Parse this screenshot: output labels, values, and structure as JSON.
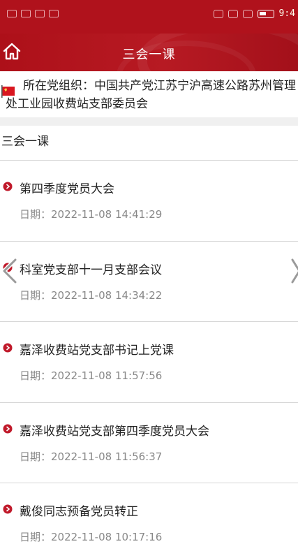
{
  "status_bar": {
    "time": "9:4"
  },
  "header": {
    "title": "三会一课",
    "home_icon": "home-icon"
  },
  "org": {
    "text": "所在党组织：中国共产党江苏宁沪高速公路苏州管理处工业园收费站支部委员会",
    "flag_icon": "party-flag-icon"
  },
  "section": {
    "title": "三会一课"
  },
  "items": [
    {
      "title": "第四季度党员大会",
      "date": "日期：2022-11-08 14:41:29"
    },
    {
      "title": "科室党支部十一月支部会议",
      "date": "日期：2022-11-08 14:34:22"
    },
    {
      "title": "嘉泽收费站党支部书记上党课",
      "date": "日期：2022-11-08 11:57:56"
    },
    {
      "title": "嘉泽收费站党支部第四季度党员大会",
      "date": "日期：2022-11-08 11:56:37"
    },
    {
      "title": "戴俊同志预备党员转正",
      "date": "日期：2022-11-08 10:17:16"
    }
  ],
  "colors": {
    "brand_red": "#b0121c",
    "bullet_red": "#c0192a",
    "date_gray": "#888888"
  }
}
